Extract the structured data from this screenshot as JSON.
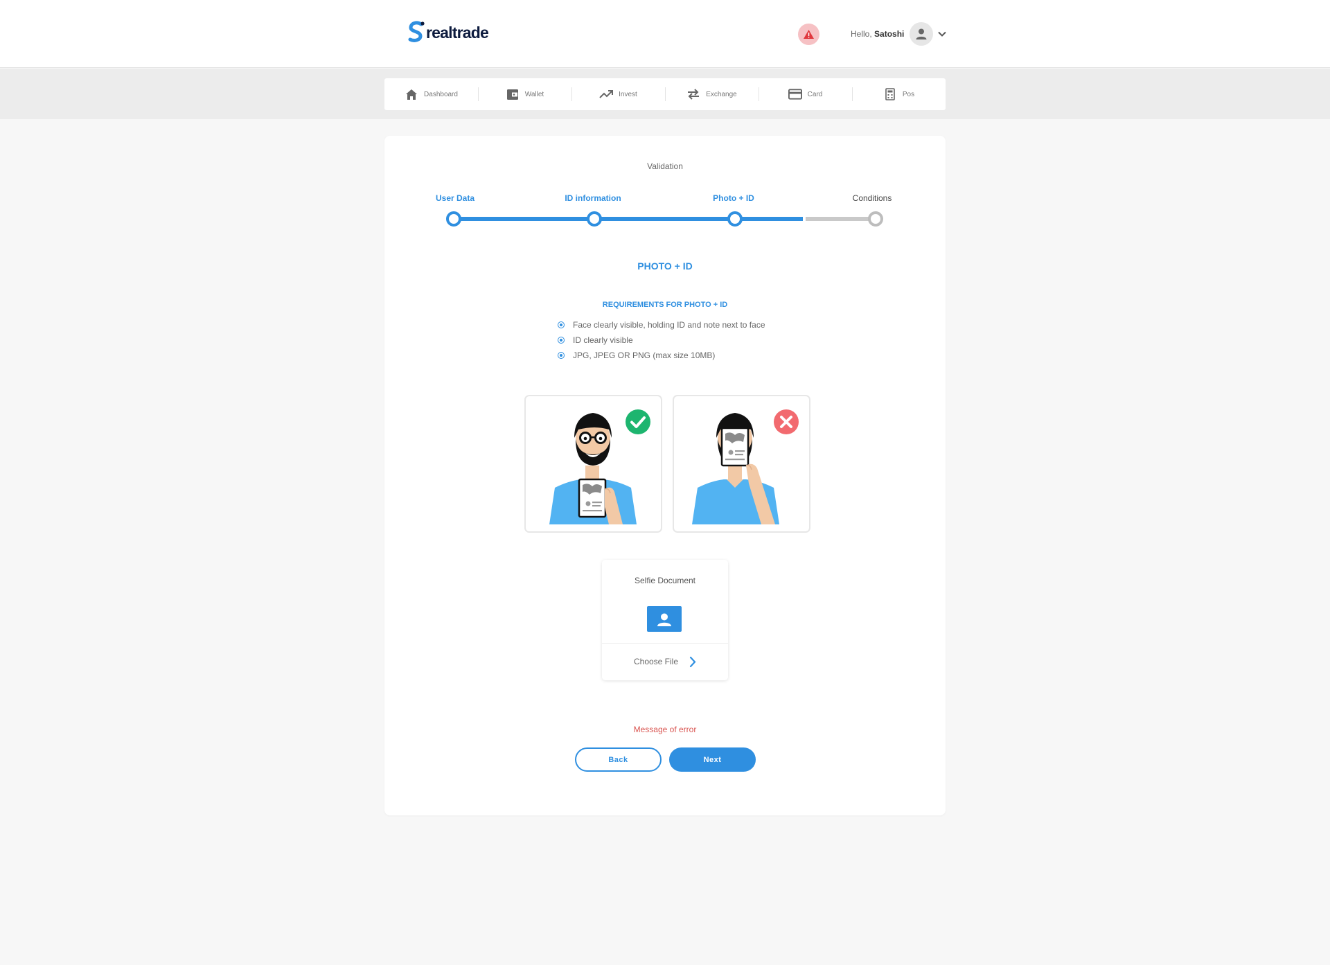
{
  "brand": {
    "name": "realtrade"
  },
  "header": {
    "greeting_prefix": "Hello, ",
    "user_name": "Satoshi"
  },
  "nav": {
    "items": [
      {
        "label": "Dashboard",
        "icon": "home-icon"
      },
      {
        "label": "Wallet",
        "icon": "wallet-icon"
      },
      {
        "label": "Invest",
        "icon": "trending-up-icon"
      },
      {
        "label": "Exchange",
        "icon": "swap-arrows-icon"
      },
      {
        "label": "Card",
        "icon": "credit-card-icon"
      },
      {
        "label": "Pos",
        "icon": "calculator-icon"
      }
    ]
  },
  "validation": {
    "title": "Validation",
    "steps": [
      {
        "label": "User Data",
        "status": "done"
      },
      {
        "label": "ID information",
        "status": "done"
      },
      {
        "label": "Photo + ID",
        "status": "current"
      },
      {
        "label": "Conditions",
        "status": "todo"
      }
    ],
    "section_title": "PHOTO + ID",
    "requirements_title": "REQUIREMENTS FOR PHOTO + ID",
    "requirements": [
      "Face clearly visible, holding ID and note next to face",
      "ID clearly visible",
      "JPG, JPEG OR PNG (max size 10MB)"
    ],
    "examples": [
      {
        "kind": "correct",
        "icon": "check-circle-icon"
      },
      {
        "kind": "incorrect",
        "icon": "x-circle-icon"
      }
    ],
    "upload": {
      "title": "Selfie Document",
      "choose_label": "Choose File"
    },
    "error_message": "Message of error",
    "back_label": "Back",
    "next_label": "Next"
  },
  "colors": {
    "accent": "#2f8fe0",
    "error": "#d9534f",
    "success": "#1db56f",
    "danger": "#f26a6f",
    "brand_dark": "#0d1b3e"
  }
}
